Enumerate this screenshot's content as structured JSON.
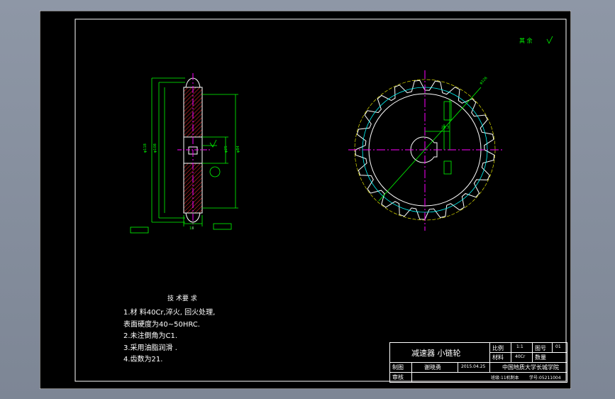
{
  "sheet": {
    "background": "#000000",
    "line_color": "#ffffff",
    "dim_color": "#00ff00",
    "section_color": "#ff0000",
    "center_color": "#ff00ff",
    "tooth_color": "#00ffff"
  },
  "roughness_note": "其 余",
  "tech_req": {
    "title": "技 术要 求",
    "items": [
      "1.材 料40Cr,淬火, 回火处理,",
      "表面硬度为40~50HRC.",
      "2.未注倒角为C1.",
      "3.采用油脂润滑 .",
      "4.齿数为21."
    ]
  },
  "title_block": {
    "part_name": "减速器 小链轮",
    "scale_label": "比例",
    "scale_value": "1:1",
    "drawing_no_label": "图号",
    "drawing_no_value": "01",
    "material_label": "材料",
    "material_value": "40Cr",
    "quantity_label": "数量",
    "drawn_label": "制图",
    "drawn_name": "谢晓勇",
    "drawn_date": "2015.04.25",
    "checked_label": "审核",
    "school": "中国地质大学长城学院",
    "footer": "班级:11机制本",
    "footer_no": "学号:05211004"
  }
}
